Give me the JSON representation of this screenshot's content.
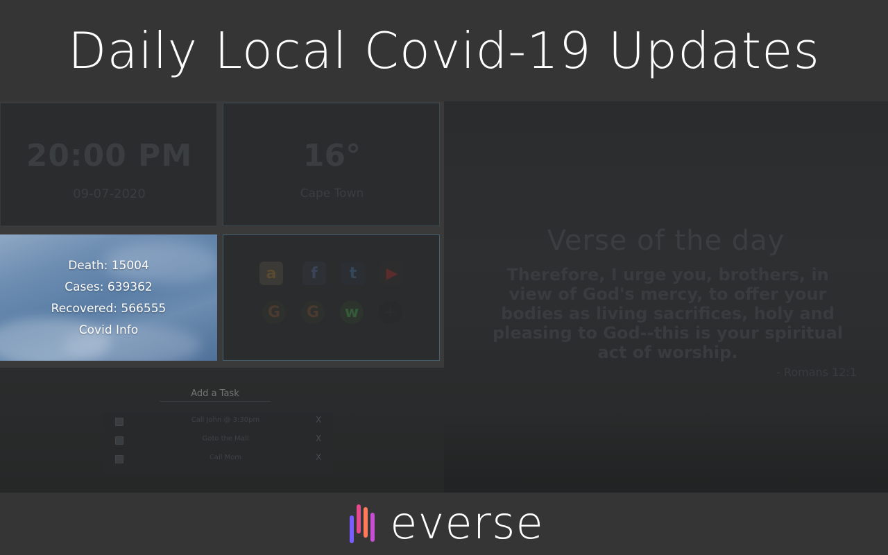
{
  "header": {
    "title": "Daily Local Covid-19 Updates"
  },
  "clock": {
    "time": "20:00 PM",
    "date": "09-07-2020"
  },
  "weather": {
    "temperature": "16°",
    "city": "Cape Town"
  },
  "covid": {
    "death": "Death: 15004",
    "cases": "Cases: 639362",
    "recovered": "Recovered: 566555",
    "info_link": "Covid Info"
  },
  "shortcuts": {
    "amazon": "a",
    "facebook": "f",
    "twitter": "t",
    "youtube": "▶",
    "google1": "G",
    "google2": "G",
    "whatsapp": "w",
    "add": "+"
  },
  "verse": {
    "title": "Verse of the day",
    "text": "Therefore, I urge you, brothers, in view of God's mercy, to offer your bodies as living sacrifices, holy and pleasing to God--this is your spiritual act of worship.",
    "reference": "- Romans 12:1"
  },
  "todo": {
    "placeholder": "Add a Task",
    "items": [
      {
        "text": "Call John @ 3:30pm",
        "remove": "X"
      },
      {
        "text": "Goto the Mall",
        "remove": "X"
      },
      {
        "text": "Call Mom",
        "remove": "X"
      }
    ]
  },
  "footer": {
    "brand": "everse"
  },
  "colors": {
    "header_bg": "#353535",
    "footer_bg": "#353535",
    "logo_bars": [
      "#7b5cff",
      "#e44b8a",
      "#ff7a5a",
      "#c44fd0"
    ]
  }
}
